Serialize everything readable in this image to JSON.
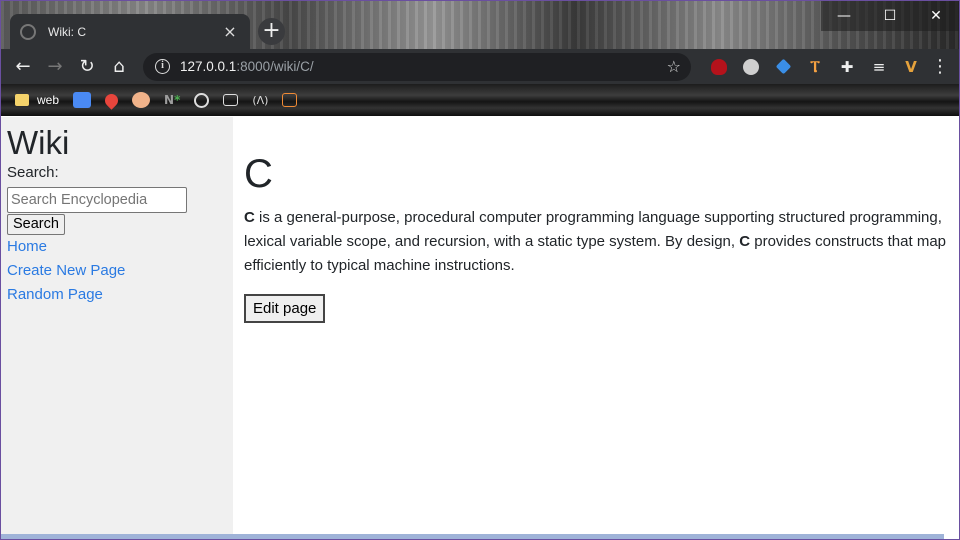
{
  "browser": {
    "tab_title": "Wiki: C",
    "tab_close": "×",
    "new_tab": "+",
    "url_host": "127.0.0.1",
    "url_path": ":8000/wiki/C/",
    "window_controls": {
      "minimize": "—",
      "maximize": "☐",
      "close": "✕"
    },
    "nav": {
      "back": "←",
      "forward": "→",
      "reload": "↻",
      "home": "⌂"
    },
    "star": "☆",
    "menu": "⋮",
    "bookmarks": [
      {
        "label": "web"
      }
    ],
    "colors": {
      "accent_link": "#2a7ae2",
      "sidebar_bg": "#f0f0f0",
      "toolbar_bg": "#2f3134"
    }
  },
  "sidebar": {
    "title": "Wiki",
    "search_label": "Search:",
    "search_placeholder": "Search Encyclopedia",
    "search_button": "Search",
    "links": [
      "Home",
      "Create New Page",
      "Random Page"
    ]
  },
  "article": {
    "title": "C",
    "body_parts": [
      "C",
      " is a general-purpose, procedural computer programming language supporting structured programming, lexical variable scope, and recursion, with a static type system. By design, ",
      "C",
      " provides constructs that map efficiently to typical machine instructions."
    ],
    "edit_button": "Edit page"
  }
}
